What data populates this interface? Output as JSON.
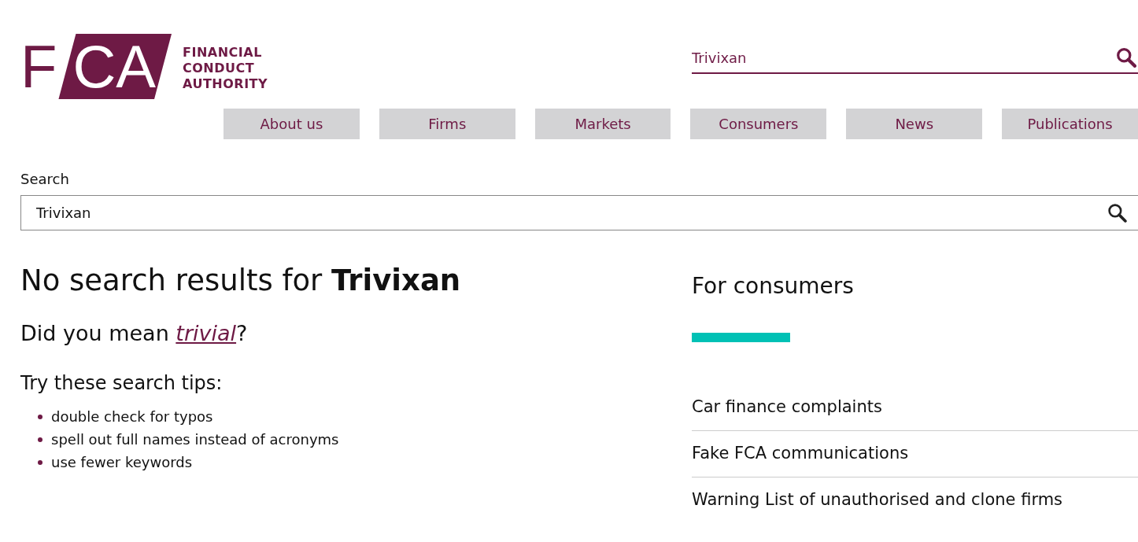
{
  "logo": {
    "mark": "FCA",
    "name": [
      "FINANCIAL",
      "CONDUCT",
      "AUTHORITY"
    ]
  },
  "header_search": {
    "value": "Trivixan"
  },
  "nav": [
    "About us",
    "Firms",
    "Markets",
    "Consumers",
    "News",
    "Publications"
  ],
  "search": {
    "label": "Search",
    "value": "Trivixan"
  },
  "results": {
    "heading": "No search results for **Trivixan**",
    "suggestion": {
      "prefix": "Did you mean",
      "link": "trivial",
      "suffix": "?"
    },
    "tips_title": "Try these search tips:",
    "tips": [
      "double check for typos",
      "spell out full names instead of acronyms",
      "use fewer keywords"
    ]
  },
  "sidebar": {
    "title": "For consumers",
    "links": [
      "Car finance complaints",
      "Fake FCA communications",
      "Warning List of unauthorised and clone firms"
    ]
  }
}
